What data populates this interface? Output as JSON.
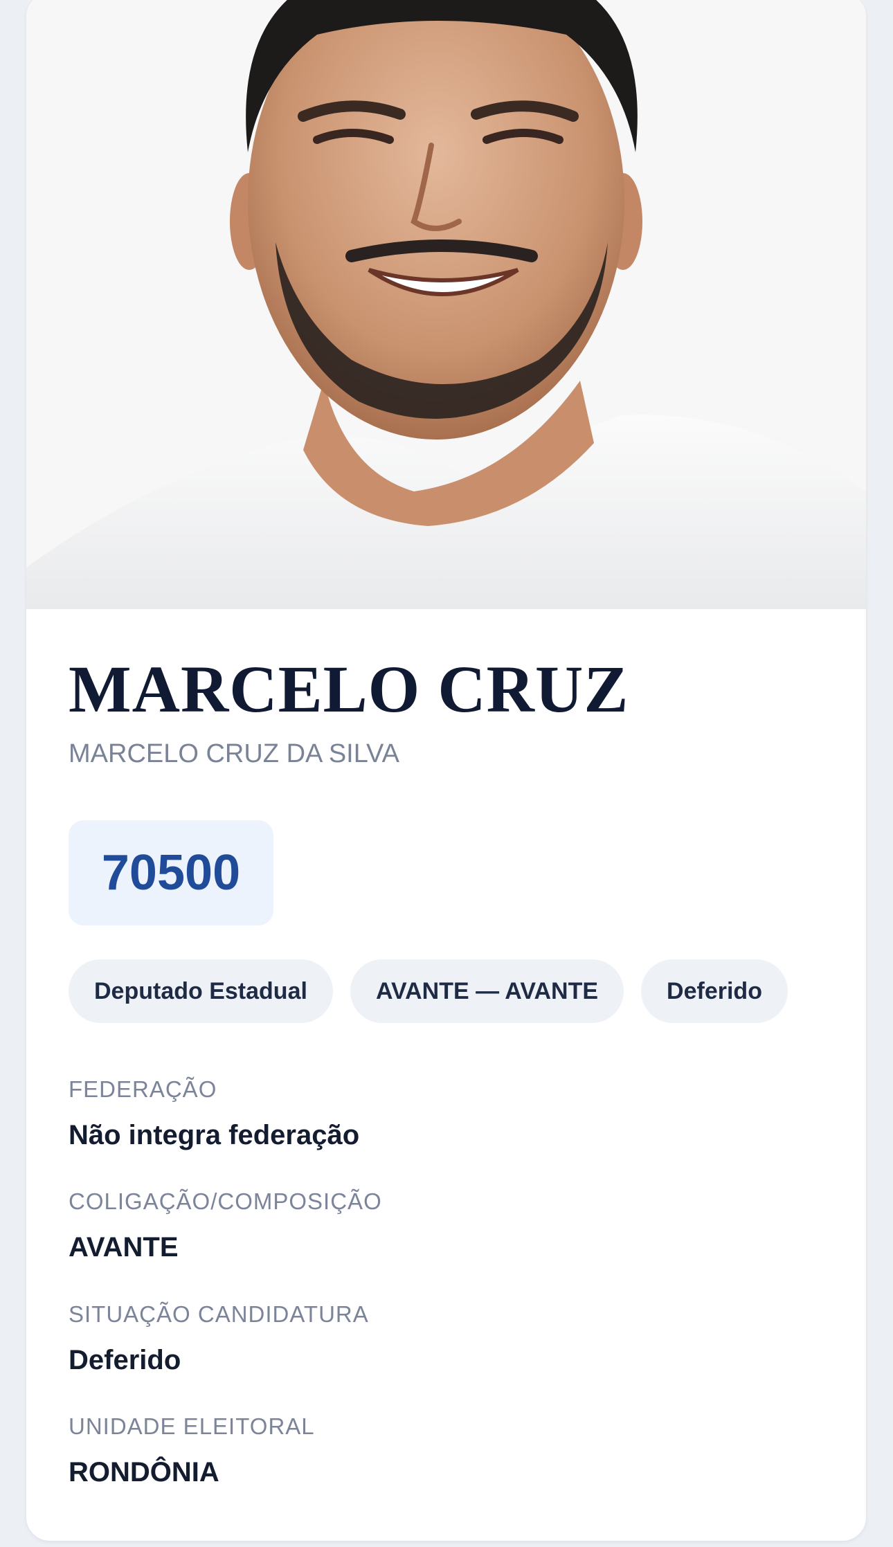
{
  "candidate": {
    "photo_icon": "candidate-portrait-image",
    "display_name": "MARCELO CRUZ",
    "full_name": "MARCELO CRUZ DA SILVA",
    "number": "70500"
  },
  "chips": [
    {
      "label": "Deputado Estadual"
    },
    {
      "label": "AVANTE — AVANTE"
    },
    {
      "label": "Deferido"
    }
  ],
  "fields": [
    {
      "label": "FEDERAÇÃO",
      "value": "Não integra federação"
    },
    {
      "label": "COLIGAÇÃO/COMPOSIÇÃO",
      "value": "AVANTE"
    },
    {
      "label": "SITUAÇÃO CANDIDATURA",
      "value": "Deferido"
    },
    {
      "label": "UNIDADE ELEITORAL",
      "value": "RONDÔNIA"
    }
  ],
  "colors": {
    "page_background": "#eceff4",
    "card_background": "#ffffff",
    "name_text": "#111a33",
    "number_text": "#1f4b99",
    "number_box": "#edf3fd",
    "chip_background": "#eef1f6"
  }
}
